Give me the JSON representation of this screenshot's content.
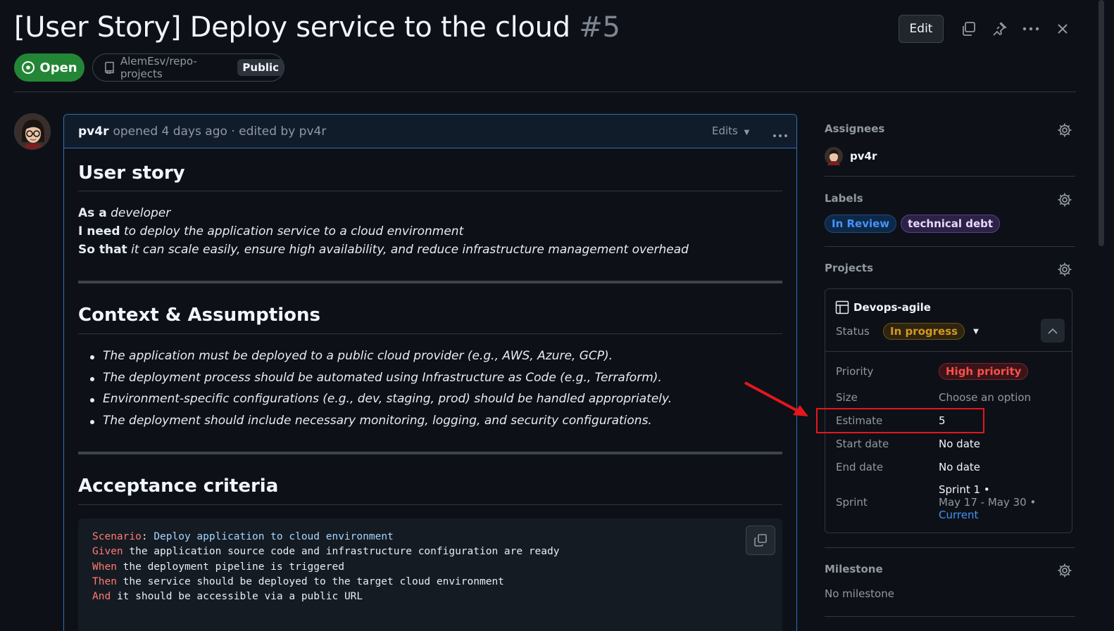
{
  "header": {
    "title": "[User Story] Deploy service to the cloud",
    "number": "#5",
    "edit_label": "Edit",
    "status_label": "Open",
    "repo": "AlemEsv/repo-projects",
    "visibility": "Public"
  },
  "comment": {
    "author": "pv4r",
    "meta": "opened 4 days ago · edited by pv4r",
    "edits_label": "Edits",
    "sections": {
      "story_heading": "User story",
      "story_lines": [
        {
          "lead": "As a",
          "text": "developer"
        },
        {
          "lead": "I need",
          "text": "to deploy the application service to a cloud environment"
        },
        {
          "lead": "So that",
          "text": "it can scale easily, ensure high availability, and reduce infrastructure management overhead"
        }
      ],
      "context_heading": "Context & Assumptions",
      "context_items": [
        "The application must be deployed to a public cloud provider (e.g., AWS, Azure, GCP).",
        "The deployment process should be automated using Infrastructure as Code (e.g., Terraform).",
        "Environment-specific configurations (e.g., dev, staging, prod) should be handled appropriately.",
        "The deployment should include necessary monitoring, logging, and security configurations."
      ],
      "acceptance_heading": "Acceptance criteria",
      "code": [
        {
          "kw": "Scenario",
          "sep": ": ",
          "rest": "Deploy application to cloud environment",
          "str": true
        },
        {
          "kw": "Given",
          "sep": " ",
          "rest": "the application source code and infrastructure configuration are ready",
          "str": false
        },
        {
          "kw": "When",
          "sep": " ",
          "rest": "the deployment pipeline is triggered",
          "str": false
        },
        {
          "kw": "Then",
          "sep": " ",
          "rest": "the service should be deployed to the target cloud environment",
          "str": false
        },
        {
          "kw": "And",
          "sep": " ",
          "rest": "it should be accessible via a public URL",
          "str": false
        }
      ]
    }
  },
  "sidebar": {
    "assignees": {
      "label": "Assignees",
      "user": "pv4r"
    },
    "labels": {
      "label": "Labels",
      "items": [
        {
          "text": "In Review",
          "color": "#4493f8"
        },
        {
          "text": "technical debt",
          "color": "#d2a8ff"
        }
      ]
    },
    "projects": {
      "label": "Projects",
      "name": "Devops-agile",
      "status_key": "Status",
      "status_value": "In progress",
      "fields": {
        "priority_key": "Priority",
        "priority_value": "High priority",
        "size_key": "Size",
        "size_value": "Choose an option",
        "estimate_key": "Estimate",
        "estimate_value": "5",
        "start_key": "Start date",
        "start_value": "No date",
        "end_key": "End date",
        "end_value": "No date",
        "sprint_key": "Sprint",
        "sprint_line1": "Sprint 1 •",
        "sprint_line2": "May 17 - May 30 •",
        "sprint_line3": "Current"
      }
    },
    "milestone": {
      "label": "Milestone",
      "value": "No milestone"
    }
  },
  "colors": {
    "accent": "#4493f8",
    "open_green": "#238636",
    "highlight_red": "#e5161d"
  }
}
